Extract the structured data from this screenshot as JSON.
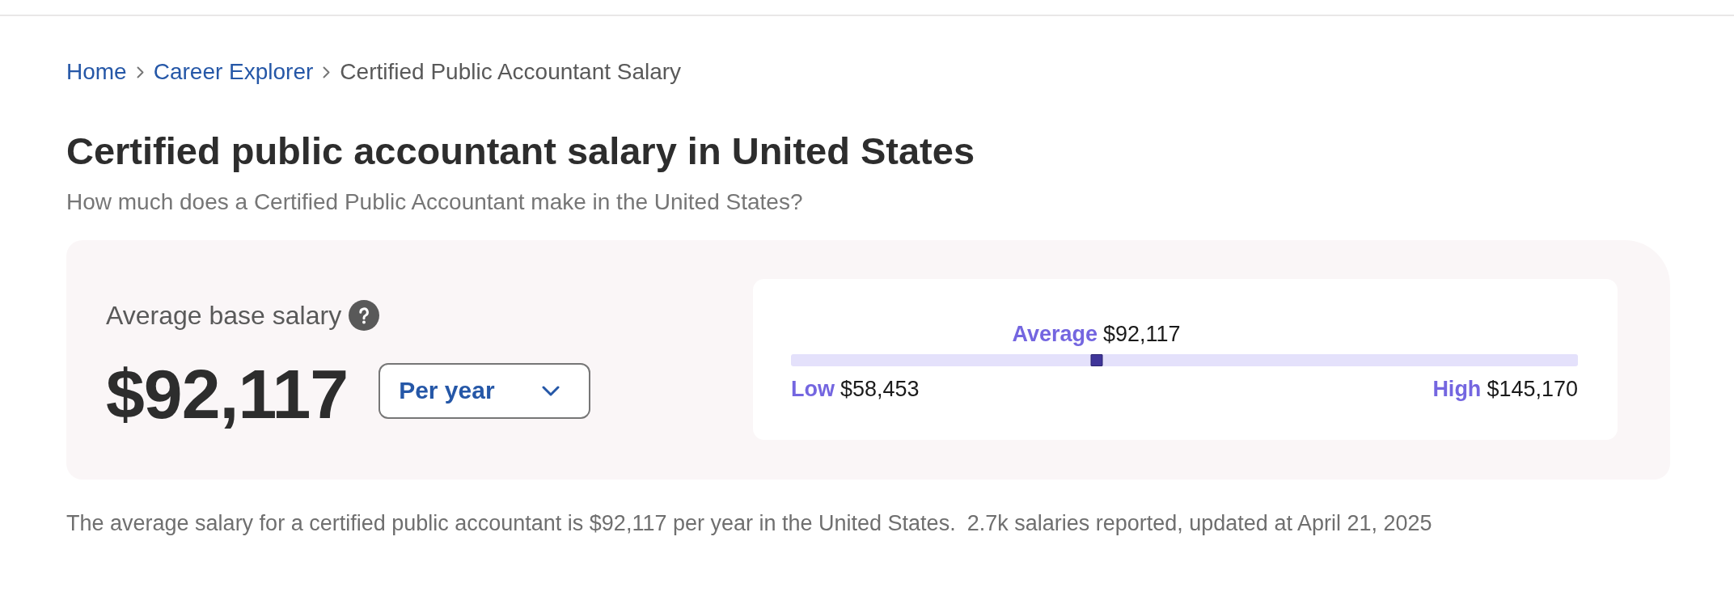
{
  "breadcrumb": [
    {
      "label": "Home",
      "kind": "link"
    },
    {
      "label": "Career Explorer",
      "kind": "link"
    },
    {
      "label": "Certified Public Accountant Salary",
      "kind": "current"
    }
  ],
  "title": "Certified public accountant salary in United States",
  "subtitle": "How much does a Certified Public Accountant make in the United States?",
  "salary_card": {
    "label": "Average base salary",
    "amount": "$92,117",
    "period_select": {
      "value": "Per year"
    },
    "range": {
      "average": {
        "label": "Average",
        "value": "$92,117"
      },
      "level": 0.388,
      "low": {
        "label": "Low",
        "value": "$58,453"
      },
      "high": {
        "label": "High",
        "value": "$145,170"
      }
    }
  },
  "footer": {
    "summary": "The average salary for a certified public accountant is $92,117 per year in the United States.",
    "stats": "2.7k salaries reported, updated at April 21, 2025"
  }
}
